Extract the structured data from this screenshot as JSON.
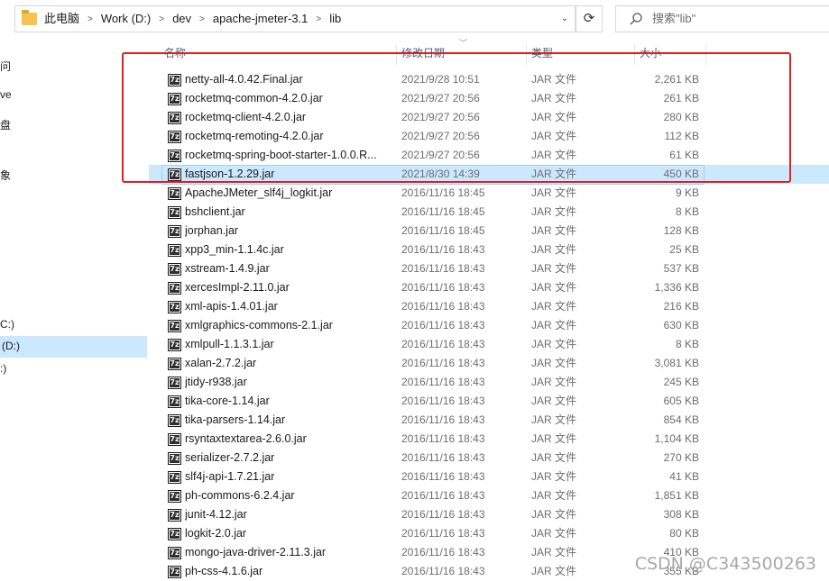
{
  "address_bar": {
    "crumbs": [
      "此电脑",
      "Work (D:)",
      "dev",
      "apache-jmeter-3.1",
      "lib"
    ],
    "dropdown_glyph": "⌄",
    "refresh_glyph": "⟳"
  },
  "search": {
    "placeholder": "搜索\"lib\"",
    "icon": "search-icon"
  },
  "sidebar": {
    "fragments": [
      "问",
      "ve",
      "盘",
      "象",
      "C:)",
      "(D:)",
      ":)"
    ],
    "selected": "(D:)"
  },
  "columns": {
    "name": "名称",
    "date": "修改日期",
    "type": "类型",
    "size": "大小"
  },
  "files": [
    {
      "name": "netty-all-4.0.42.Final.jar",
      "date": "2021/9/28 10:51",
      "type": "JAR 文件",
      "size": "2,261 KB"
    },
    {
      "name": "rocketmq-common-4.2.0.jar",
      "date": "2021/9/27 20:56",
      "type": "JAR 文件",
      "size": "261 KB"
    },
    {
      "name": "rocketmq-client-4.2.0.jar",
      "date": "2021/9/27 20:56",
      "type": "JAR 文件",
      "size": "280 KB"
    },
    {
      "name": "rocketmq-remoting-4.2.0.jar",
      "date": "2021/9/27 20:56",
      "type": "JAR 文件",
      "size": "112 KB"
    },
    {
      "name": "rocketmq-spring-boot-starter-1.0.0.R...",
      "date": "2021/9/27 20:56",
      "type": "JAR 文件",
      "size": "61 KB"
    },
    {
      "name": "fastjson-1.2.29.jar",
      "date": "2021/8/30 14:39",
      "type": "JAR 文件",
      "size": "450 KB",
      "selected": true
    },
    {
      "name": "ApacheJMeter_slf4j_logkit.jar",
      "date": "2016/11/16 18:45",
      "type": "JAR 文件",
      "size": "9 KB"
    },
    {
      "name": "bshclient.jar",
      "date": "2016/11/16 18:45",
      "type": "JAR 文件",
      "size": "8 KB"
    },
    {
      "name": "jorphan.jar",
      "date": "2016/11/16 18:45",
      "type": "JAR 文件",
      "size": "128 KB"
    },
    {
      "name": "xpp3_min-1.1.4c.jar",
      "date": "2016/11/16 18:43",
      "type": "JAR 文件",
      "size": "25 KB"
    },
    {
      "name": "xstream-1.4.9.jar",
      "date": "2016/11/16 18:43",
      "type": "JAR 文件",
      "size": "537 KB"
    },
    {
      "name": "xercesImpl-2.11.0.jar",
      "date": "2016/11/16 18:43",
      "type": "JAR 文件",
      "size": "1,336 KB"
    },
    {
      "name": "xml-apis-1.4.01.jar",
      "date": "2016/11/16 18:43",
      "type": "JAR 文件",
      "size": "216 KB"
    },
    {
      "name": "xmlgraphics-commons-2.1.jar",
      "date": "2016/11/16 18:43",
      "type": "JAR 文件",
      "size": "630 KB"
    },
    {
      "name": "xmlpull-1.1.3.1.jar",
      "date": "2016/11/16 18:43",
      "type": "JAR 文件",
      "size": "8 KB"
    },
    {
      "name": "xalan-2.7.2.jar",
      "date": "2016/11/16 18:43",
      "type": "JAR 文件",
      "size": "3,081 KB"
    },
    {
      "name": "jtidy-r938.jar",
      "date": "2016/11/16 18:43",
      "type": "JAR 文件",
      "size": "245 KB"
    },
    {
      "name": "tika-core-1.14.jar",
      "date": "2016/11/16 18:43",
      "type": "JAR 文件",
      "size": "605 KB"
    },
    {
      "name": "tika-parsers-1.14.jar",
      "date": "2016/11/16 18:43",
      "type": "JAR 文件",
      "size": "854 KB"
    },
    {
      "name": "rsyntaxtextarea-2.6.0.jar",
      "date": "2016/11/16 18:43",
      "type": "JAR 文件",
      "size": "1,104 KB"
    },
    {
      "name": "serializer-2.7.2.jar",
      "date": "2016/11/16 18:43",
      "type": "JAR 文件",
      "size": "270 KB"
    },
    {
      "name": "slf4j-api-1.7.21.jar",
      "date": "2016/11/16 18:43",
      "type": "JAR 文件",
      "size": "41 KB"
    },
    {
      "name": "ph-commons-6.2.4.jar",
      "date": "2016/11/16 18:43",
      "type": "JAR 文件",
      "size": "1,851 KB"
    },
    {
      "name": "junit-4.12.jar",
      "date": "2016/11/16 18:43",
      "type": "JAR 文件",
      "size": "308 KB"
    },
    {
      "name": "logkit-2.0.jar",
      "date": "2016/11/16 18:43",
      "type": "JAR 文件",
      "size": "80 KB"
    },
    {
      "name": "mongo-java-driver-2.11.3.jar",
      "date": "2016/11/16 18:43",
      "type": "JAR 文件",
      "size": "410 KB"
    },
    {
      "name": "ph-css-4.1.6.jar",
      "date": "2016/11/16 18:43",
      "type": "JAR 文件",
      "size": "355 KB"
    }
  ],
  "watermark": "CSDN @C343500263",
  "colors": {
    "selection": "#cce8ff",
    "annotation": "#e02020",
    "header_text": "#4c607a"
  }
}
